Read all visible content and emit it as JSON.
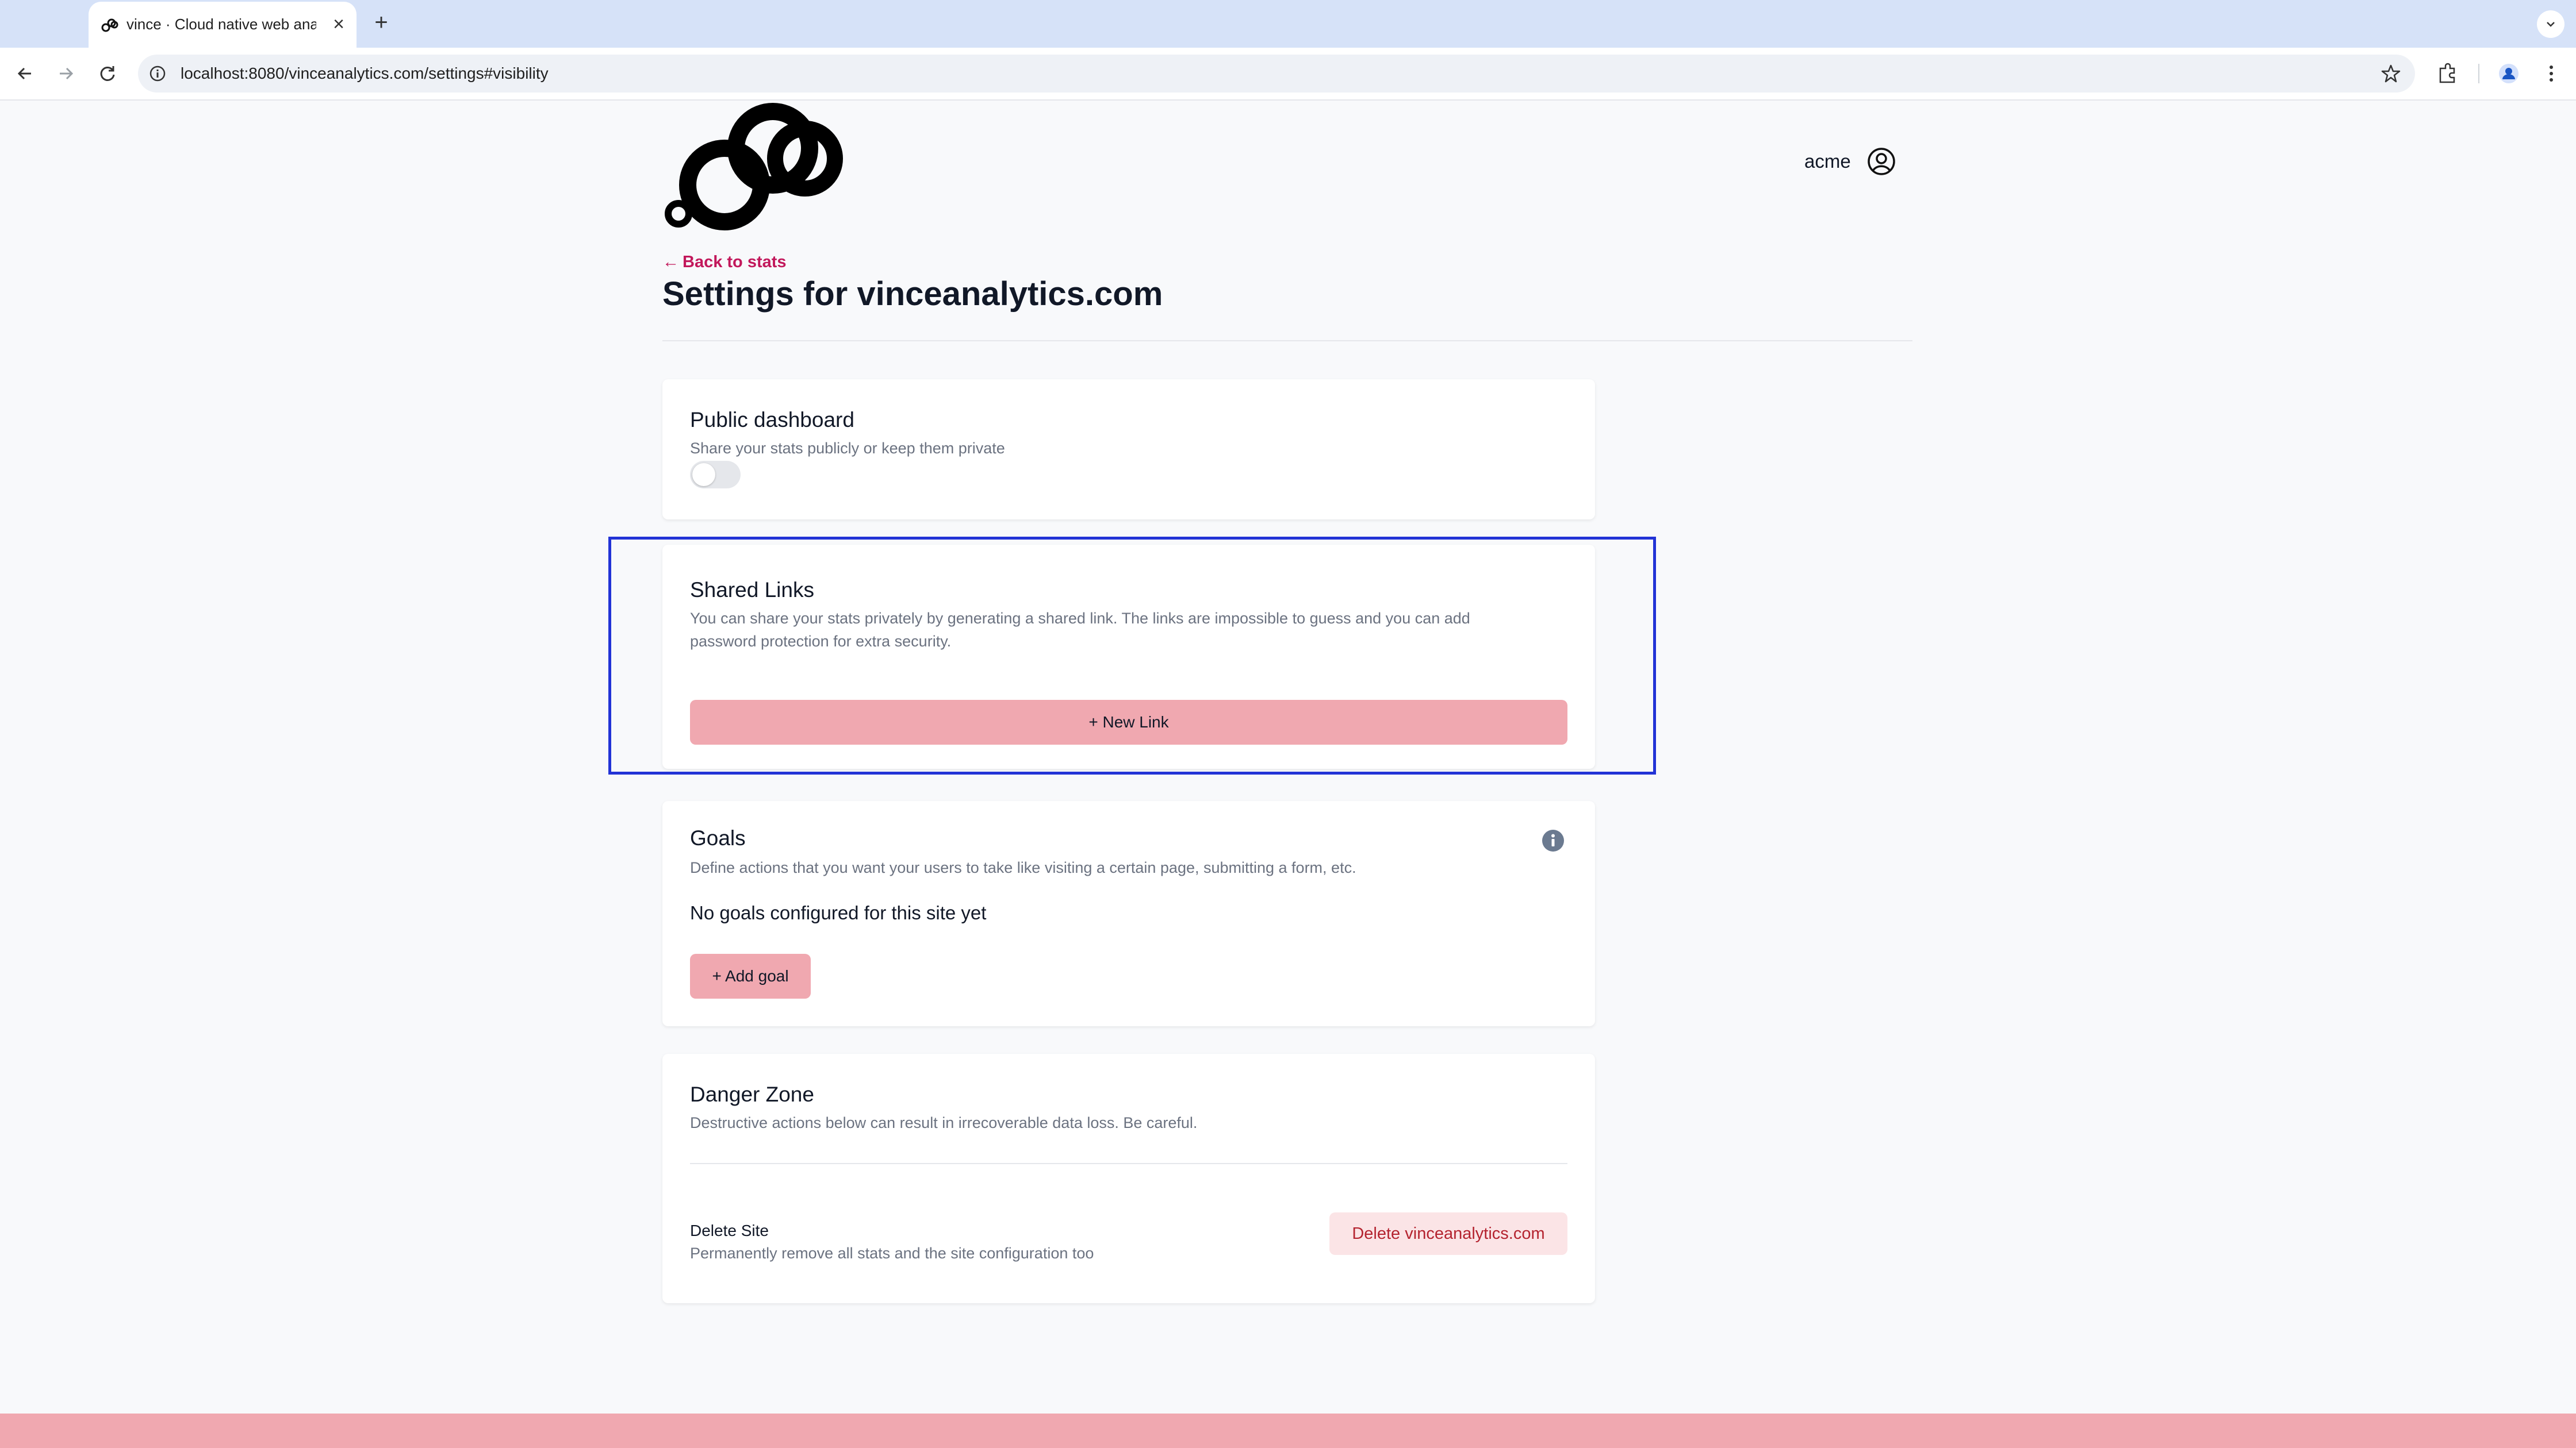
{
  "browser": {
    "tab_title": "vince · Cloud native web anal",
    "url": "localhost:8080/vinceanalytics.com/settings#visibility",
    "icons": {
      "tab_favicon": "vince-logo-icon",
      "tab_close": "close-icon",
      "new_tab": "plus-icon",
      "tab_search": "chevron-down-icon",
      "back": "arrow-left-icon",
      "forward": "arrow-right-icon",
      "reload": "reload-icon",
      "site_info": "info-circle-icon",
      "bookmark": "star-icon",
      "extensions": "puzzle-icon",
      "profile": "profile-icon",
      "menu": "kebab-menu-icon"
    }
  },
  "header": {
    "account_name": "acme",
    "logo_icon": "vince-logo",
    "account_icon": "user-circle-icon"
  },
  "page": {
    "back_link": "Back to stats",
    "title": "Settings for vinceanalytics.com"
  },
  "sections": {
    "public_dashboard": {
      "title": "Public dashboard",
      "description": "Share your stats publicly or keep them private",
      "toggle_on": false
    },
    "shared_links": {
      "title": "Shared Links",
      "description_line1": "You can share your stats privately by generating a shared link. The links are impossible to guess and you can add",
      "description_line2": "password protection for extra security.",
      "button": "+ New Link"
    },
    "goals": {
      "title": "Goals",
      "description": "Define actions that you want your users to take like visiting a certain page, submitting a form, etc.",
      "empty_text": "No goals configured for this site yet",
      "button": "+ Add goal",
      "info_icon": "info-icon"
    },
    "danger_zone": {
      "title": "Danger Zone",
      "description": "Destructive actions below can result in irrecoverable data loss. Be careful.",
      "delete_label": "Delete Site",
      "delete_description": "Permanently remove all stats and the site configuration too",
      "delete_button": "Delete vinceanalytics.com"
    }
  },
  "colors": {
    "accent": "#f0a8b0",
    "link": "#c2185b",
    "danger_text": "#b4232f",
    "highlight_border": "#2233d6"
  }
}
